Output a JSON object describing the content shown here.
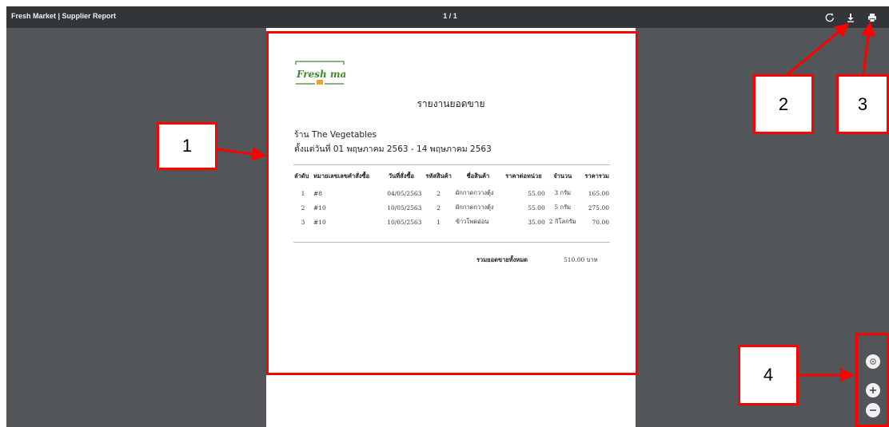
{
  "toolbar": {
    "title": "Fresh Market | Supplier Report",
    "page_counter": "1 / 1",
    "buttons": [
      {
        "name": "rotate-icon"
      },
      {
        "name": "download-icon"
      },
      {
        "name": "print-icon"
      }
    ]
  },
  "document": {
    "logo_text": "Fresh market",
    "report_title": "รายงานยอดขาย",
    "shop_line": "ร้าน The Vegetables",
    "date_range": "ตั้งแต่วันที่ 01 พฤษภาคม 2563 - 14 พฤษภาคม 2563",
    "table": {
      "headers": [
        "ลำดับ",
        "หมายเลขเลขคำสั่งซื้อ",
        "วันที่สั่งซื้อ",
        "รหัสสินค้า",
        "ชื่อสินค้า",
        "ราคาต่อหน่วย",
        "จำนวน",
        "ราคารวม"
      ],
      "rows": [
        [
          "1",
          "#8",
          "04/05/2563",
          "2",
          "ผักกาดกวางตุ้ง",
          "55.00",
          "3 กรัม",
          "165.00"
        ],
        [
          "2",
          "#10",
          "10/05/2563",
          "2",
          "ผักกาดกวางตุ้ง",
          "55.00",
          "5 กรัม",
          "275.00"
        ],
        [
          "3",
          "#10",
          "10/05/2563",
          "1",
          "ข้าวโพดอ่อน",
          "35.00",
          "2 กิโลกรัม",
          "70.00"
        ]
      ]
    },
    "total_label": "รวมยอดขายทั้งหมด",
    "total_value": "510.00 บาท"
  },
  "callouts": {
    "c1": "1",
    "c2": "2",
    "c3": "3",
    "c4": "4"
  },
  "zoom_controls": [
    {
      "name": "fit-page-icon"
    },
    {
      "name": "zoom-in-icon"
    },
    {
      "name": "zoom-out-icon"
    }
  ],
  "colors": {
    "annotation": "#ff0000",
    "viewer_bg": "#525659",
    "toolbar_bg": "#323639",
    "logo_green": "#3e8a2a",
    "logo_orange": "#e8a33a"
  }
}
